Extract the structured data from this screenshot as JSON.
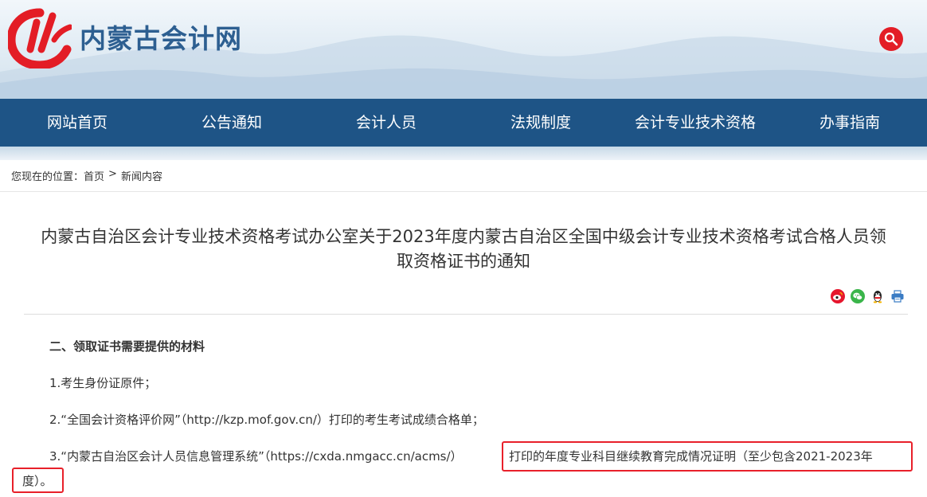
{
  "header": {
    "site_title": "内蒙古会计网",
    "logo_icon": "site-logo-icon",
    "search_icon": "search-icon",
    "accent_color": "#e31d26"
  },
  "nav": {
    "items": [
      {
        "label": "网站首页"
      },
      {
        "label": "公告通知"
      },
      {
        "label": "会计人员"
      },
      {
        "label": "法规制度"
      },
      {
        "label": "会计专业技术资格"
      },
      {
        "label": "办事指南"
      }
    ],
    "background": "#1e5486"
  },
  "breadcrumb": {
    "prefix": "您现在的位置：",
    "home": "首页",
    "separator": ">",
    "current": "新闻内容"
  },
  "article": {
    "title_line1": "内蒙古自治区会计专业技术资格考试办公室关于2023年度内蒙古自治区全国中级会计专业技术资格考试合格人员领",
    "title_line2": "取资格证书的通知",
    "share_icons": [
      "weibo-icon",
      "wechat-icon",
      "qq-icon",
      "print-icon"
    ],
    "section_heading": "二、领取证书需要提供的材料",
    "item1": "1.考生身份证原件；",
    "item2": "2.“全国会计资格评价网”（http://kzp.mof.gov.cn/）打印的考生考试成绩合格单；",
    "item3_left": "3.“内蒙古自治区会计人员信息管理系统”（https://cxda.nmgacc.cn/acms/）",
    "item3_right": "打印的年度专业科目继续教育完成情况证明（至少包含2021-2023年",
    "item3_tail": "度）。",
    "highlight_color": "#e8202a"
  }
}
